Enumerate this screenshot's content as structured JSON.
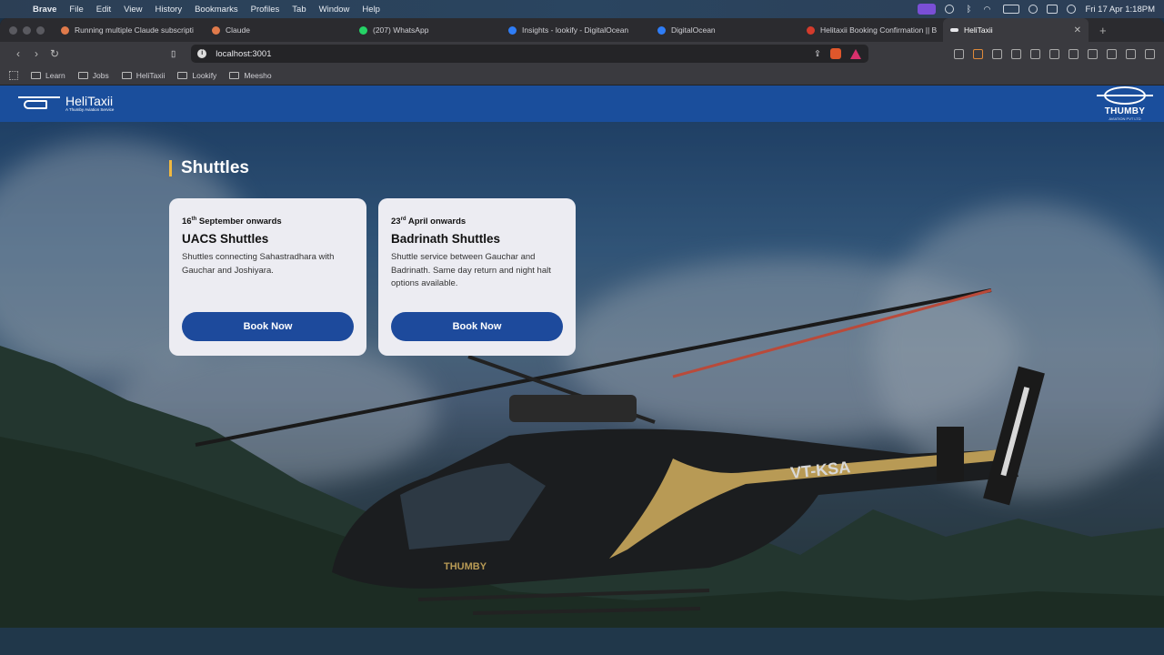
{
  "menubar": {
    "app": "Brave",
    "items": [
      "File",
      "Edit",
      "View",
      "History",
      "Bookmarks",
      "Profiles",
      "Tab",
      "Window",
      "Help"
    ],
    "datetime": "Fri 17 Apr  1:18PM"
  },
  "tabs": [
    {
      "label": "Running multiple Claude subscripti",
      "color": "#e07a4b"
    },
    {
      "label": "Claude",
      "color": "#e07a4b"
    },
    {
      "label": "(207) WhatsApp",
      "color": "#25d366"
    },
    {
      "label": "Insights - lookify - DigitalOcean",
      "color": "#2f7df6"
    },
    {
      "label": "DigitalOcean",
      "color": "#2f7df6"
    },
    {
      "label": "Helitaxii Booking Confirmation || B",
      "color": "#d33b2c"
    },
    {
      "label": "HeliTaxii",
      "color": "#e6e6ea"
    }
  ],
  "url": "localhost:3001",
  "bookmarks": [
    "Learn",
    "Jobs",
    "HeliTaxii",
    "Lookify",
    "Meesho"
  ],
  "site": {
    "brand": "HeliTaxii",
    "brand_sub": "A Thumby Aviation Service",
    "partner": "THUMBY",
    "partner_sub": "AVIATION PVT LTD"
  },
  "section_title": "Shuttles",
  "cards": [
    {
      "date_num": "16",
      "date_sup": "th",
      "date_rest": " September onwards",
      "title": "UACS Shuttles",
      "desc": "Shuttles connecting Sahastradhara with Gauchar and Joshiyara.",
      "button": "Book Now"
    },
    {
      "date_num": "23",
      "date_sup": "rd",
      "date_rest": " April onwards",
      "title": "Badrinath Shuttles",
      "desc": "Shuttle service between Gauchar and Badrinath. Same day return and night halt options available.",
      "button": "Book Now"
    }
  ],
  "colors": {
    "header": "#1a4e9c",
    "button": "#1d4a9c",
    "accent": "#f0b840"
  }
}
